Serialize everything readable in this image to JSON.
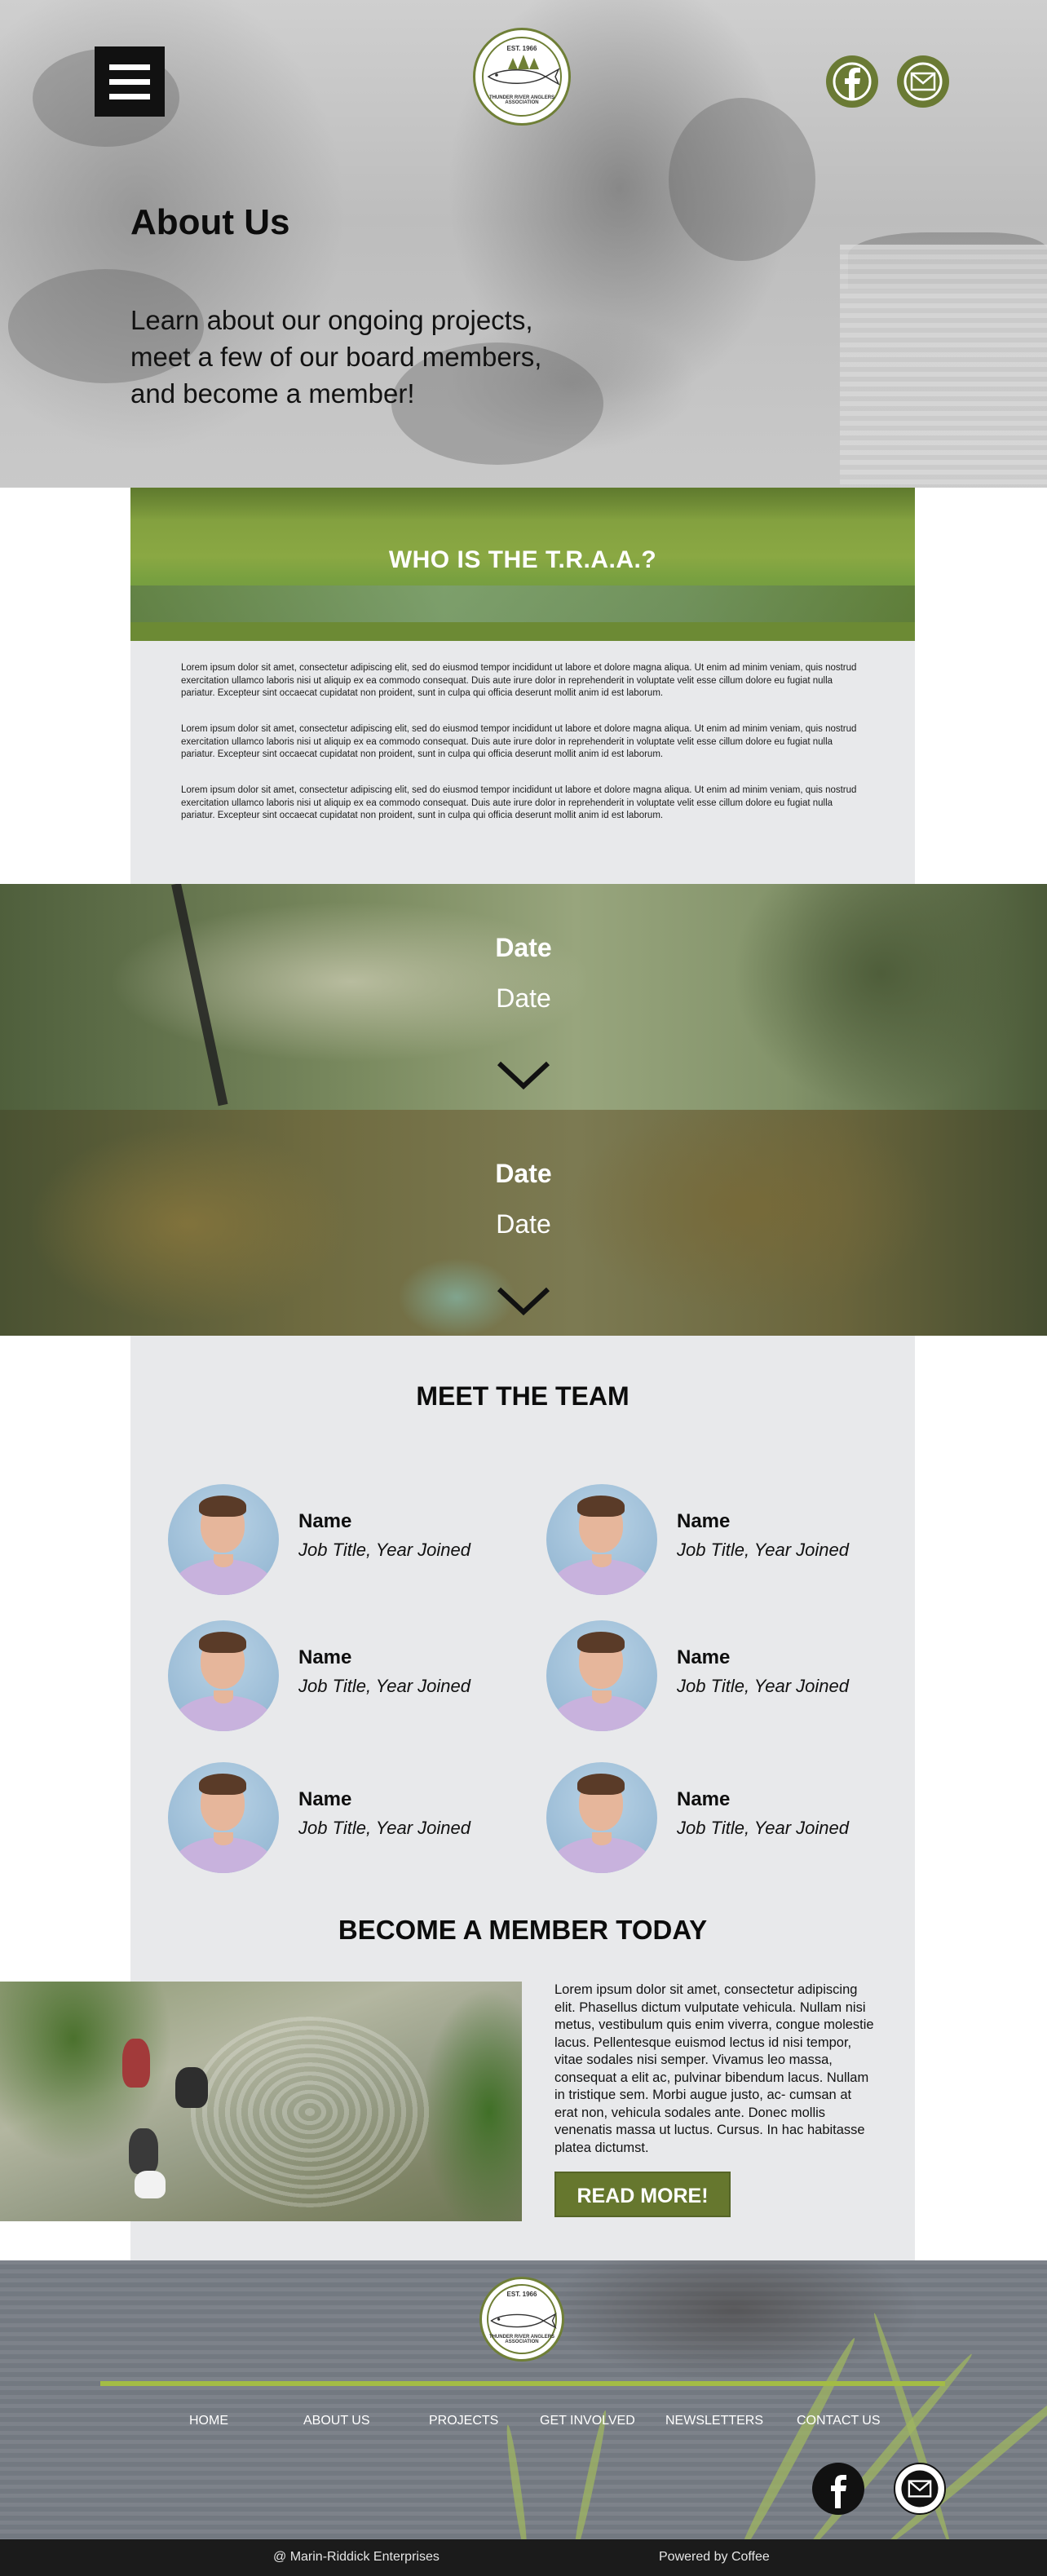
{
  "hero": {
    "menu_label": "menu",
    "logo": {
      "est": "EST. 1966",
      "name": "THUNDER RIVER ANGLERS ASSOCIATION",
      "tagline": "ANGLERS 1966"
    },
    "title": "About Us",
    "subtitle": "Learn about our ongoing projects, meet a few of our board members, and become a member!"
  },
  "who": {
    "title": "WHO IS THE T.R.A.A.?",
    "paragraphs": [
      "Lorem ipsum dolor sit amet, consectetur adipiscing elit, sed do eiusmod tempor incididunt ut labore et dolore magna aliqua. Ut enim ad minim veniam, quis nostrud exercitation ullamco laboris nisi ut aliquip ex ea commodo consequat. Duis aute irure dolor in reprehenderit in voluptate velit esse cillum dolore eu fugiat nulla pariatur. Excepteur sint occaecat cupidatat non proident, sunt in culpa qui officia deserunt mollit anim id est laborum.",
      "Lorem ipsum dolor sit amet, consectetur adipiscing elit, sed do eiusmod tempor incididunt ut labore et dolore magna aliqua. Ut enim ad minim veniam, quis nostrud exercitation ullamco laboris nisi ut aliquip ex ea commodo consequat. Duis aute irure dolor in reprehenderit in voluptate velit esse cillum dolore eu fugiat nulla pariatur. Excepteur sint occaecat cupidatat non proident, sunt in culpa qui officia deserunt mollit anim id est laborum.",
      "Lorem ipsum dolor sit amet, consectetur adipiscing elit, sed do eiusmod tempor incididunt ut labore et dolore magna aliqua. Ut enim ad minim veniam, quis nostrud exercitation ullamco laboris nisi ut aliquip ex ea commodo consequat. Duis aute irure dolor in reprehenderit in voluptate velit esse cillum dolore eu fugiat nulla pariatur. Excepteur sint occaecat cupidatat non proident, sunt in culpa qui officia deserunt mollit anim id est laborum."
    ]
  },
  "events": [
    {
      "title": "Date",
      "subtitle": "Date"
    },
    {
      "title": "Date",
      "subtitle": "Date"
    }
  ],
  "team": {
    "title": "MEET THE TEAM",
    "members": [
      {
        "name": "Name",
        "role": "Job Title, Year Joined"
      },
      {
        "name": "Name",
        "role": "Job Title, Year Joined"
      },
      {
        "name": "Name",
        "role": "Job Title, Year Joined"
      },
      {
        "name": "Name",
        "role": "Job Title, Year Joined"
      },
      {
        "name": "Name",
        "role": "Job Title, Year Joined"
      },
      {
        "name": "Name",
        "role": "Job Title, Year Joined"
      }
    ]
  },
  "join": {
    "title": "BECOME A MEMBER TODAY",
    "body": "Lorem ipsum dolor sit amet, consectetur adipiscing elit. Phasellus dictum vulputate vehicula. Nullam nisi metus, vestibulum quis enim viverra, congue molestie lacus. Pellentesque euismod lectus id nisi tempor, vitae sodales nisi semper. Vivamus leo massa, consequat a elit ac, pulvinar bibendum lacus. Nullam in tristique sem. Morbi augue justo, ac- cumsan at erat non, vehicula sodales ante. Donec mollis venenatis massa ut luctus. Cursus. In hac habitasse platea dictumst.",
    "button": "READ MORE!"
  },
  "footer": {
    "nav": [
      "HOME",
      "ABOUT US",
      "PROJECTS",
      "GET INVOLVED",
      "NEWSLETTERS",
      "CONTACT US"
    ],
    "copyright": "@ Marin-Riddick Enterprises",
    "powered": "Powered by Coffee"
  },
  "icons": {
    "menu": "hamburger-icon",
    "facebook": "facebook-icon",
    "email": "envelope-icon",
    "expand": "chevron-down-icon"
  },
  "colors": {
    "brand_green": "#66772e",
    "banner_green": "#8aa843",
    "panel_gray": "#e8e9eb",
    "footer_rule": "#a3bc46"
  }
}
